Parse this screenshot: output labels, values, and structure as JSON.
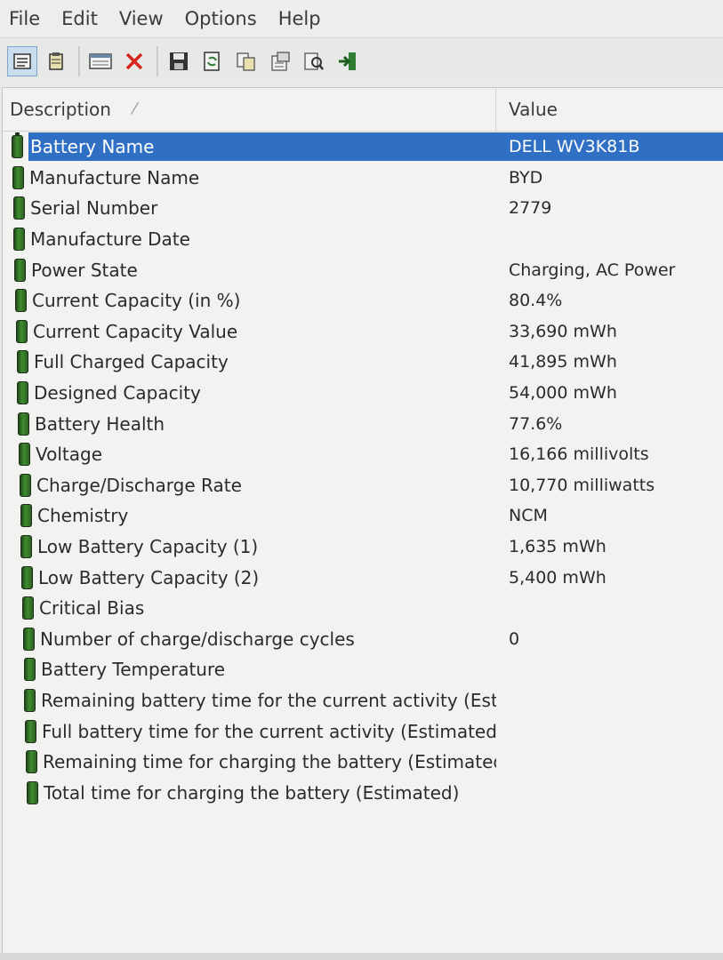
{
  "menu": [
    "File",
    "Edit",
    "View",
    "Options",
    "Help"
  ],
  "toolbar": {
    "buttons": [
      {
        "icon": "properties-icon",
        "pressed": true
      },
      {
        "icon": "clipboard-icon",
        "pressed": false
      },
      {
        "icon": "window-icon",
        "pressed": false
      },
      {
        "icon": "delete-icon",
        "pressed": false
      },
      {
        "icon": "save-icon",
        "pressed": false
      },
      {
        "icon": "refresh-icon",
        "pressed": false
      },
      {
        "icon": "copy-icon",
        "pressed": false
      },
      {
        "icon": "options-icon",
        "pressed": false
      },
      {
        "icon": "find-icon",
        "pressed": false
      },
      {
        "icon": "exit-icon",
        "pressed": false
      }
    ]
  },
  "columns": {
    "description": "Description",
    "value": "Value"
  },
  "rows": [
    {
      "description": "Battery Name",
      "value": "DELL WV3K81B",
      "selected": true
    },
    {
      "description": "Manufacture Name",
      "value": "BYD"
    },
    {
      "description": "Serial Number",
      "value": "2779"
    },
    {
      "description": "Manufacture Date",
      "value": ""
    },
    {
      "description": "Power State",
      "value": "Charging, AC Power"
    },
    {
      "description": "Current Capacity (in %)",
      "value": "80.4%"
    },
    {
      "description": "Current Capacity Value",
      "value": "33,690 mWh"
    },
    {
      "description": "Full Charged Capacity",
      "value": "41,895 mWh"
    },
    {
      "description": "Designed Capacity",
      "value": "54,000 mWh"
    },
    {
      "description": "Battery Health",
      "value": "77.6%"
    },
    {
      "description": "Voltage",
      "value": "16,166 millivolts"
    },
    {
      "description": "Charge/Discharge Rate",
      "value": "10,770 milliwatts"
    },
    {
      "description": "Chemistry",
      "value": "NCM"
    },
    {
      "description": "Low Battery Capacity (1)",
      "value": "1,635 mWh"
    },
    {
      "description": "Low Battery Capacity (2)",
      "value": "5,400 mWh"
    },
    {
      "description": "Critical Bias",
      "value": ""
    },
    {
      "description": "Number of charge/discharge cycles",
      "value": "0"
    },
    {
      "description": "Battery Temperature",
      "value": ""
    },
    {
      "description": "Remaining battery time for the current activity (Esti...",
      "value": ""
    },
    {
      "description": "Full battery time for the current activity (Estimated)",
      "value": ""
    },
    {
      "description": "Remaining time for charging the battery (Estimated)",
      "value": ""
    },
    {
      "description": "Total  time for charging the battery (Estimated)",
      "value": ""
    }
  ],
  "colors": {
    "selection": "#2f6fc4",
    "battery_icon": "#3f8d2f"
  }
}
